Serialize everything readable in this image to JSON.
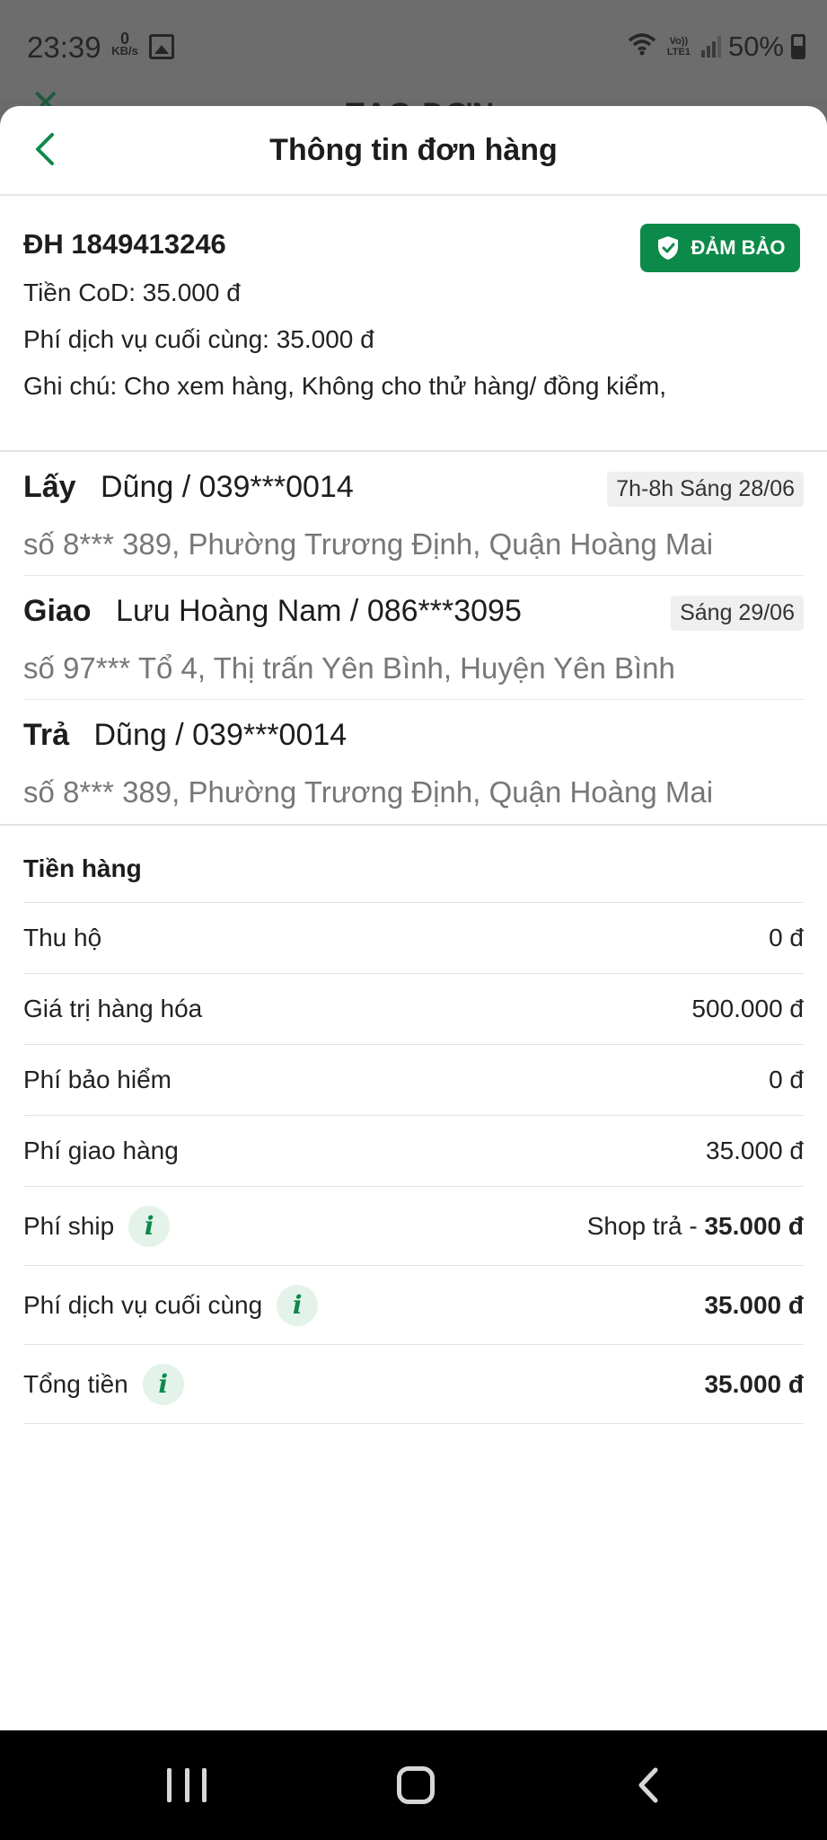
{
  "status_bar": {
    "time": "23:39",
    "net_speed_value": "0",
    "net_speed_unit": "KB/s",
    "volte_label": "Vo)) LTE1",
    "battery": "50%"
  },
  "behind": {
    "title": "TẠO ĐƠN"
  },
  "sheet": {
    "title": "Thông tin đơn hàng",
    "order": {
      "id": "ĐH 1849413246",
      "badge": "ĐẢM BẢO",
      "cod": "Tiền CoD: 35.000 đ",
      "final_fee": "Phí dịch vụ cuối cùng: 35.000 đ",
      "note": "Ghi chú:  Cho xem hàng, Không cho thử hàng/ đồng kiểm,"
    },
    "stops": [
      {
        "kind": "Lấy",
        "contact": "Dũng / 039***0014",
        "time": "7h-8h Sáng 28/06",
        "address": "số 8*** 389, Phường Trương Định, Quận Hoàng Mai"
      },
      {
        "kind": "Giao",
        "contact": "Lưu Hoàng Nam / 086***3095",
        "time": "Sáng 29/06",
        "address": "số 97*** Tổ 4, Thị trấn Yên Bình, Huyện Yên Bình"
      },
      {
        "kind": "Trả",
        "contact": "Dũng / 039***0014",
        "time": "",
        "address": "số 8*** 389, Phường Trương Định, Quận Hoàng Mai"
      }
    ],
    "money": {
      "title": "Tiền hàng",
      "rows": [
        {
          "label": "Thu hộ",
          "value": "0 đ"
        },
        {
          "label": "Giá trị hàng hóa",
          "value": "500.000 đ"
        },
        {
          "label": "Phí bảo hiểm",
          "value": "0 đ"
        },
        {
          "label": "Phí giao hàng",
          "value": "35.000 đ"
        },
        {
          "label": "Phí ship",
          "prefix": "Shop trả - ",
          "value": "35.000 đ"
        },
        {
          "label": "Phí dịch vụ cuối cùng",
          "value": "35.000 đ"
        },
        {
          "label": "Tổng tiền",
          "value": "35.000 đ"
        }
      ]
    }
  },
  "colors": {
    "brand_green": "#0c8a4a",
    "info_bg": "#e3f3ea"
  },
  "icons": {
    "back": "chevron-left-icon",
    "badge": "shield-check-icon",
    "info": "info-icon"
  }
}
